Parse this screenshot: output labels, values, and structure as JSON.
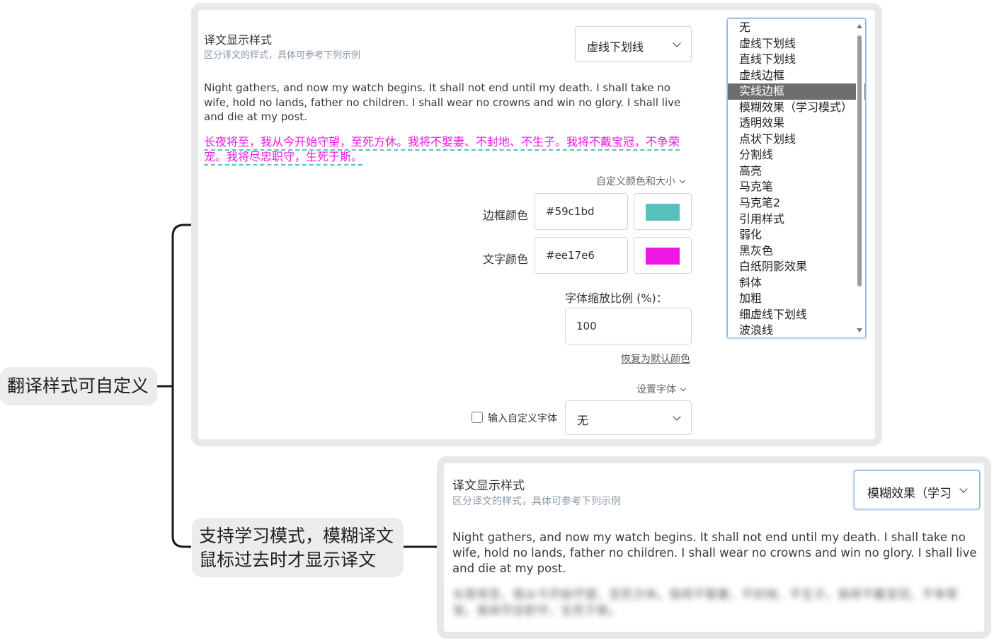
{
  "colors": {
    "panel_border": "#e8e8e8",
    "node_bg": "#ececec",
    "connector": "#1a1a1a",
    "translation_text": "#ee17e6",
    "translation_underline": "#59c1bd",
    "listbox_selected_bg": "#6e6e6e"
  },
  "left_node": {
    "text": "翻译样式可自定义"
  },
  "bottom_node": {
    "line1": "支持学习模式，模糊译文",
    "line2": "鼠标过去时才显示译文"
  },
  "top_panel": {
    "title": "译文显示样式",
    "subtitle": "区分译文的样式，具体可参考下列示例",
    "style_select_value": "虚线下划线",
    "original_text": "Night gathers, and now my watch begins. It shall not end until my death. I shall take no wife, hold no lands, father no children. I shall wear no crowns and win no glory. I shall live and die at my post.",
    "translation_text": "长夜将至，我从今开始守望，至死方休。我将不娶妻、不封地、不生子。我将不戴宝冠，不争荣宠。我将尽忠职守，生死于斯。",
    "custom_color_toggle": "自定义颜色和大小",
    "border_color_label": "边框颜色",
    "border_color_value": "#59c1bd",
    "text_color_label": "文字颜色",
    "text_color_value": "#ee17e6",
    "font_scale_label": "字体缩放比例 (%)：",
    "font_scale_value": "100",
    "reset_link": "恢复为默认颜色",
    "font_toggle": "设置字体",
    "custom_font_checkbox_label": "输入自定义字体",
    "custom_font_checked": false,
    "font_select_value": "无"
  },
  "style_options": {
    "selected": "实线边框",
    "items": [
      "无",
      "虚线下划线",
      "直线下划线",
      "虚线边框",
      "实线边框",
      "模糊效果（学习模式）",
      "透明效果",
      "点状下划线",
      "分割线",
      "高亮",
      "马克笔",
      "马克笔2",
      "引用样式",
      "弱化",
      "黑灰色",
      "白纸阴影效果",
      "斜体",
      "加粗",
      "细虚线下划线",
      "波浪线"
    ]
  },
  "bottom_panel": {
    "title": "译文显示样式",
    "subtitle": "区分译文的样式，具体可参考下列示例",
    "style_select_value": "模糊效果（学习模式）",
    "original_text": "Night gathers, and now my watch begins. It shall not end until my death. I shall take no wife, hold no lands, father no children. I shall wear no crowns and win no glory. I shall live and die at my post.",
    "blurred_translation": "长夜将至，我从今开始守望，至死方休。我将不娶妻、不封地、不生子。我将不戴宝冠，不争荣宠。我将尽忠职守，生死于斯。"
  }
}
